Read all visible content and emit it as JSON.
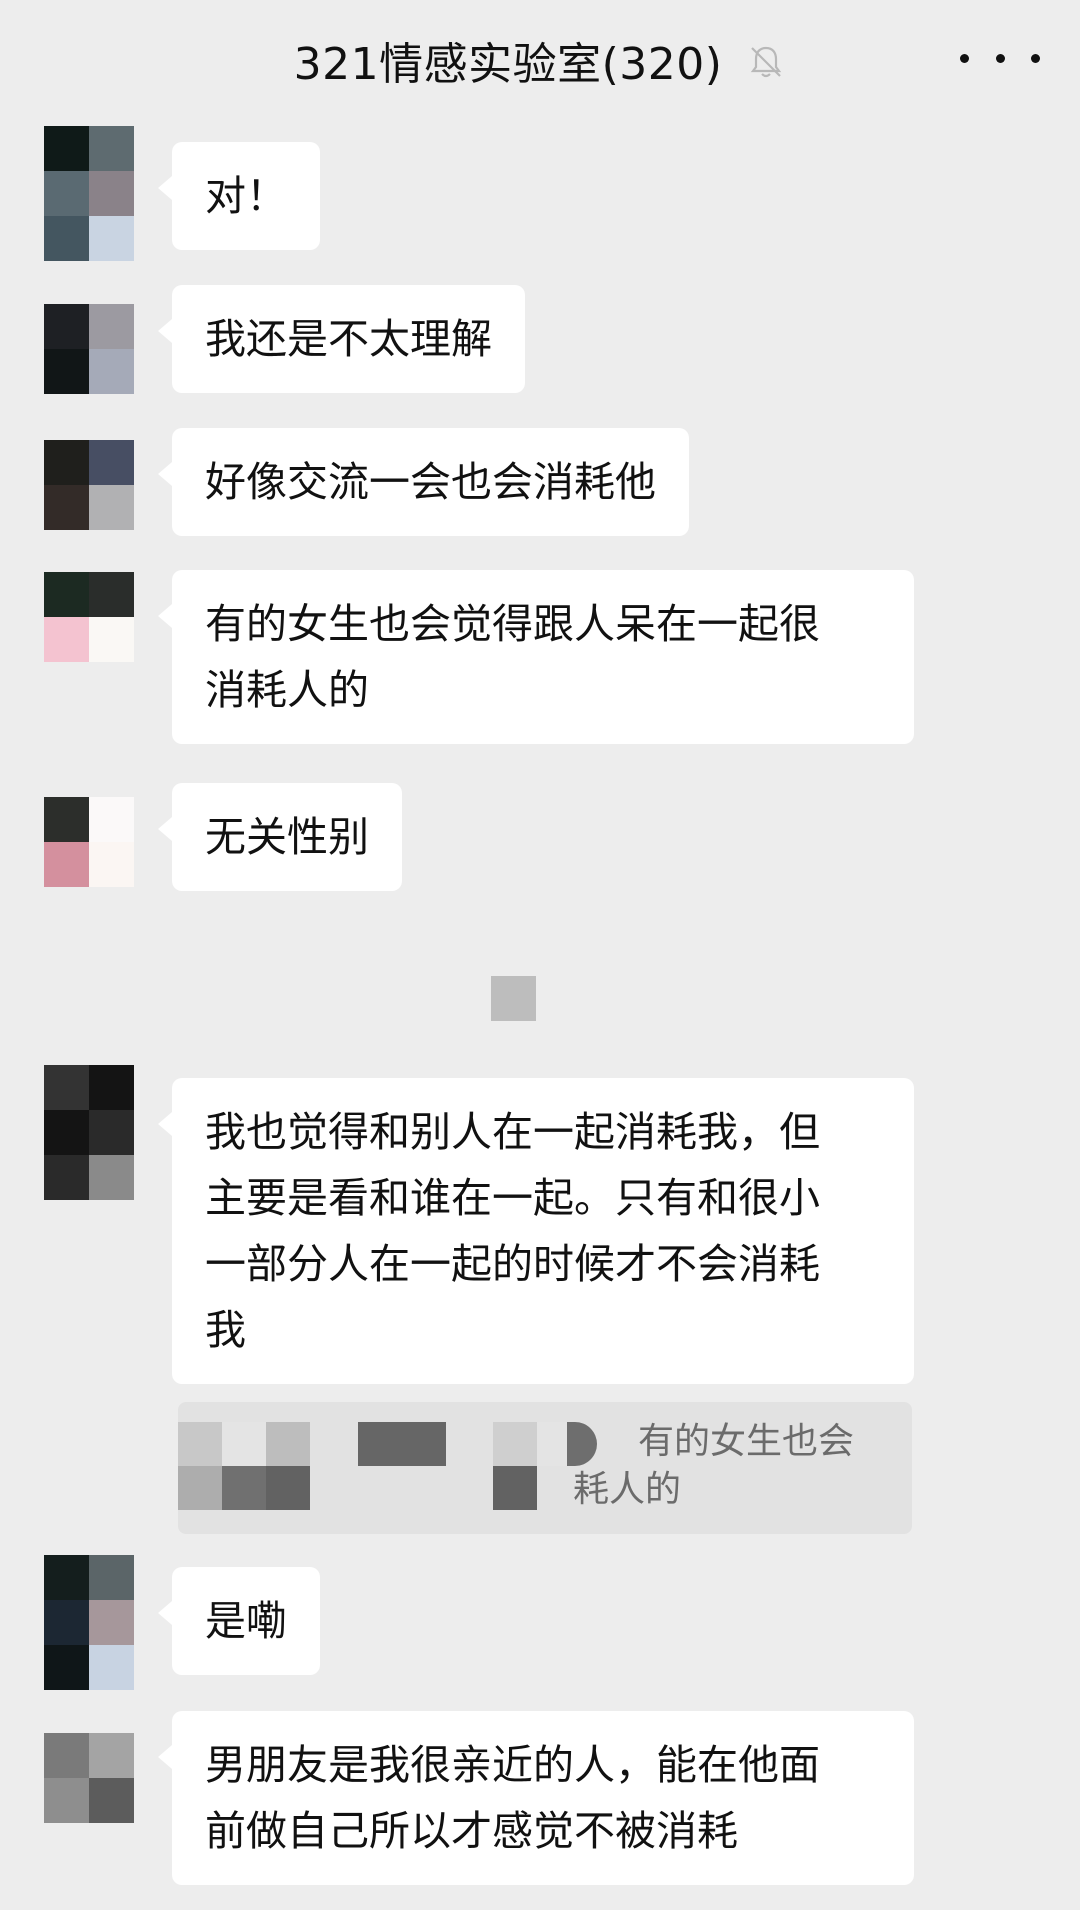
{
  "header": {
    "title": "321情感实验室(320)",
    "mute_icon": "bell-off-icon",
    "more_icon": "more-dots-icon"
  },
  "messages": [
    {
      "text": "对！",
      "avatar_colors": [
        "#0f1a18",
        "#5e6b70",
        "#5a6a72",
        "#8a8289",
        "#445660",
        "#c9d4e2"
      ]
    },
    {
      "text": "我还是不太理解",
      "avatar_colors": [
        "#1e2024",
        "#9c9aa1",
        "#111617",
        "#a5aab8"
      ]
    },
    {
      "text": "好像交流一会也会消耗他",
      "avatar_colors": [
        "#1f1f1c",
        "#474e63",
        "#332b28",
        "#b1b1b3"
      ]
    },
    {
      "text": "有的女生也会觉得跟人呆在一起很\n消耗人的",
      "avatar_colors": [
        "#1c2a22",
        "#2a2d2b",
        "#f4c3d0",
        "#faf8f5"
      ]
    },
    {
      "text": "无关性别",
      "avatar_colors": [
        "#2c2e2b",
        "#fbf9f9",
        "#d4909e",
        "#fbf6f3"
      ]
    },
    {
      "text": "我也觉得和别人在一起消耗我，但\n主要是看和谁在一起。只有和很小\n一部分人在一起的时候才不会消耗\n我",
      "avatar_colors": [
        "#333333",
        "#141414",
        "#141414",
        "#2a2a2a",
        "#2a2a2a",
        "#8a8a8a"
      ]
    },
    {
      "text": "是嘞",
      "avatar_colors": [
        "#141e1d",
        "#5b6568",
        "#1c2733",
        "#a6979b",
        "#0f1618",
        "#c8d3e2"
      ]
    },
    {
      "text": "男朋友是我很亲近的人，能在他面\n前做自己所以才感觉不被消耗",
      "avatar_colors": [
        "#7a7a7a",
        "#a4a4a4",
        "#8e8e8e",
        "#5c5c5c"
      ]
    }
  ],
  "quote": {
    "line1": "有的女生也会",
    "line2": "耗人的"
  },
  "system_icon": "mosaic-icon"
}
